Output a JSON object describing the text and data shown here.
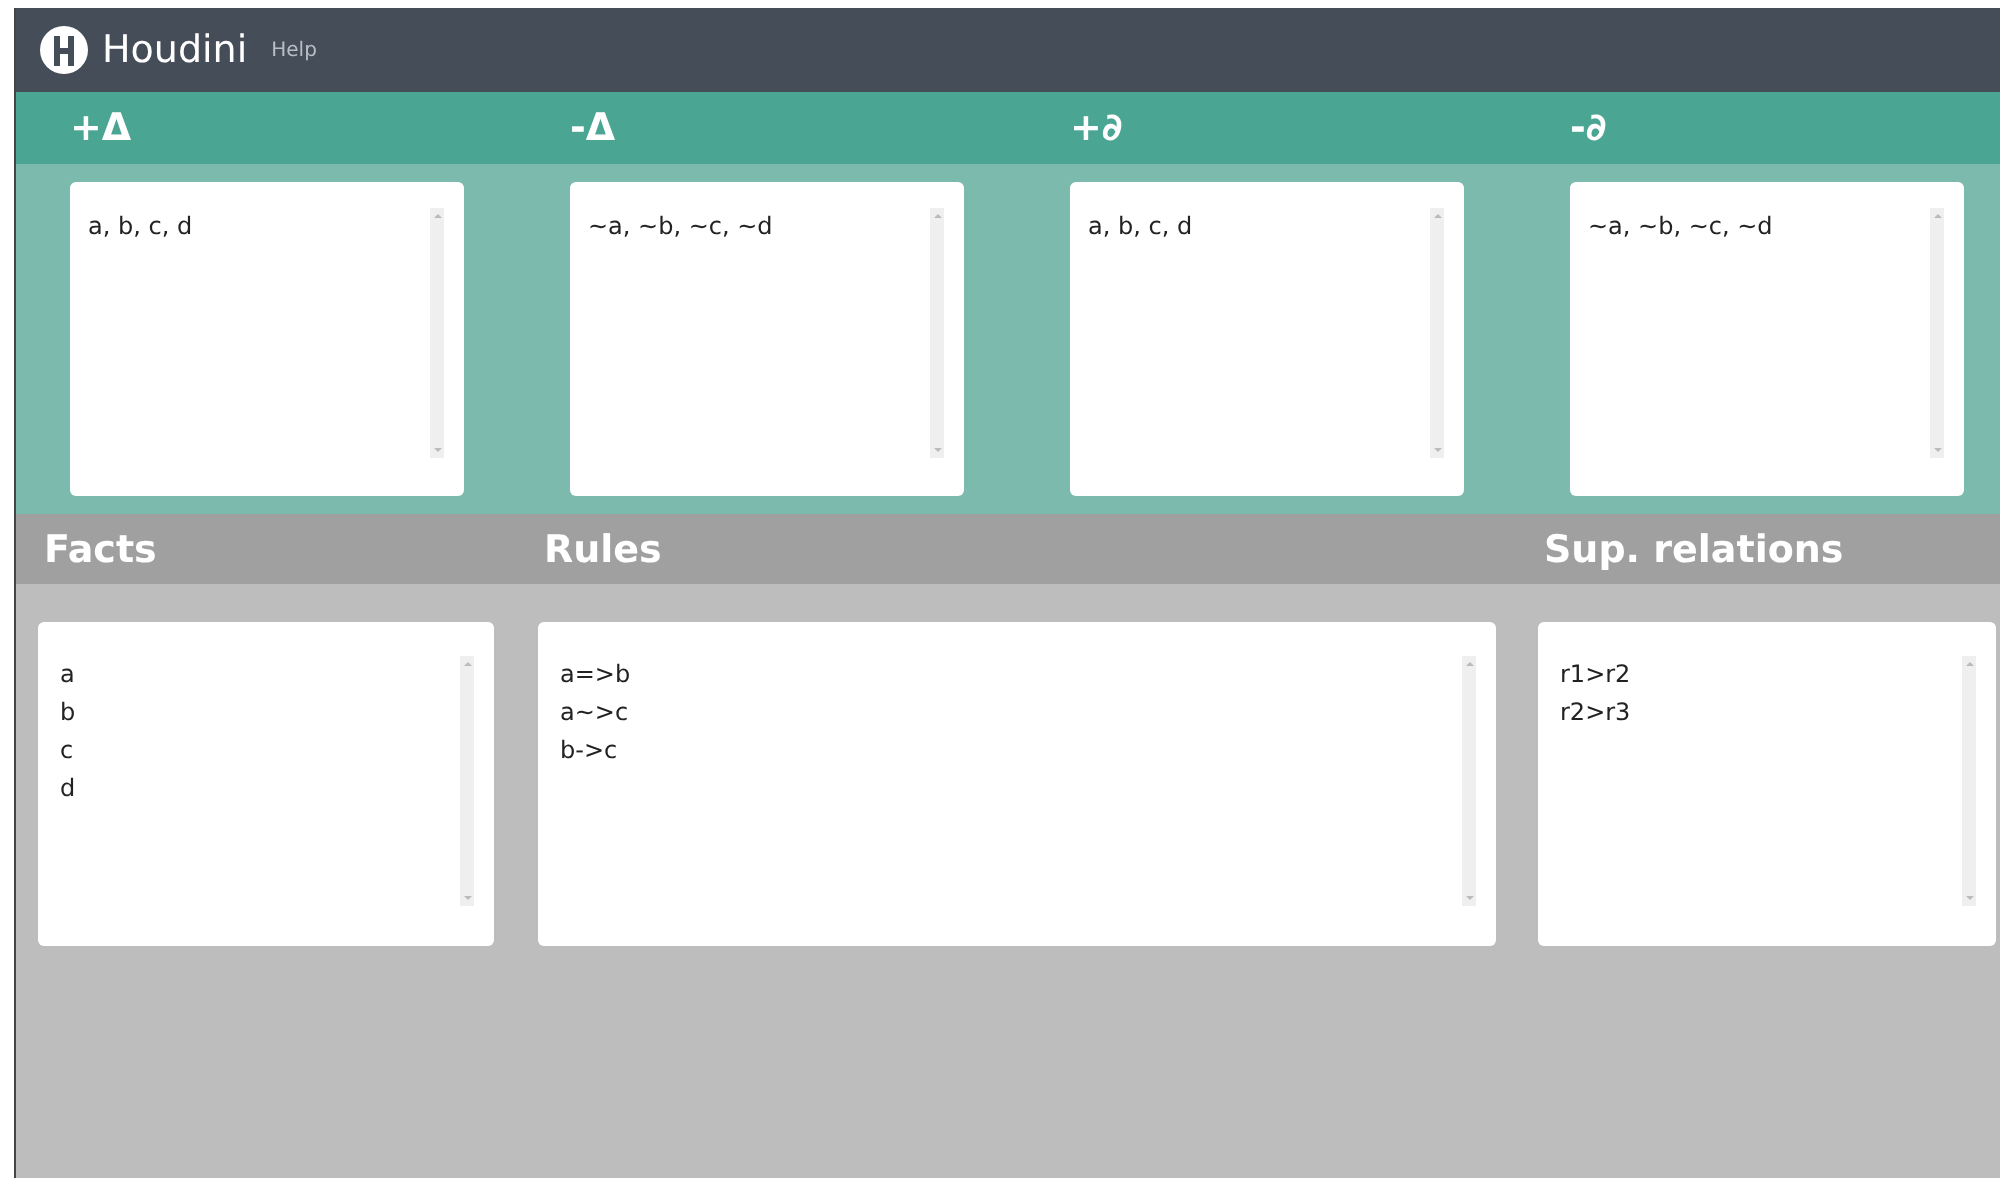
{
  "navbar": {
    "brand": "Houdini",
    "links": [
      {
        "label": "Help"
      }
    ]
  },
  "conclusions": [
    {
      "title": "+Δ",
      "text": "a, b, c, d"
    },
    {
      "title": "-Δ",
      "text": "~a, ~b, ~c, ~d"
    },
    {
      "title": "+∂",
      "text": "a, b, c, d"
    },
    {
      "title": "-∂",
      "text": "~a, ~b, ~c, ~d"
    }
  ],
  "theory": [
    {
      "title": "Facts",
      "text": "a\nb\nc\nd",
      "kind": "narrow"
    },
    {
      "title": "Rules",
      "text": "a=>b\na~>c\nb->c",
      "kind": "wide"
    },
    {
      "title": "Sup. relations",
      "text": "r1>r2\nr2>r3",
      "kind": "narrow"
    }
  ]
}
